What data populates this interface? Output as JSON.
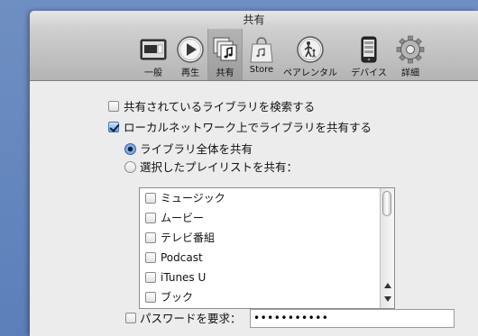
{
  "window": {
    "title": "共有"
  },
  "toolbar": {
    "items": [
      {
        "label": "一般",
        "icon": "general-switch-icon"
      },
      {
        "label": "再生",
        "icon": "play-icon"
      },
      {
        "label": "共有",
        "icon": "sharing-icon",
        "selected": true
      },
      {
        "label": "Store",
        "icon": "store-bag-icon"
      },
      {
        "label": "ペアレンタル",
        "icon": "parental-icon"
      },
      {
        "label": "デバイス",
        "icon": "device-ipod-icon"
      },
      {
        "label": "詳細",
        "icon": "gear-icon"
      }
    ]
  },
  "sharing": {
    "find_shared": {
      "label": "共有されているライブラリを検索する",
      "checked": false
    },
    "share_local": {
      "label": "ローカルネットワーク上でライブラリを共有する",
      "checked": true
    },
    "share_entire": {
      "label": "ライブラリ全体を共有",
      "selected": true
    },
    "share_selected": {
      "label": "選択したプレイリストを共有：",
      "selected": false
    },
    "playlists": [
      {
        "label": "ミュージック",
        "checked": false
      },
      {
        "label": "ムービー",
        "checked": false
      },
      {
        "label": "テレビ番組",
        "checked": false
      },
      {
        "label": "Podcast",
        "checked": false
      },
      {
        "label": "iTunes U",
        "checked": false
      },
      {
        "label": "ブック",
        "checked": false
      }
    ],
    "require_password": {
      "label": "パスワードを要求：",
      "checked": false
    },
    "password_value": "•••••••••••"
  }
}
